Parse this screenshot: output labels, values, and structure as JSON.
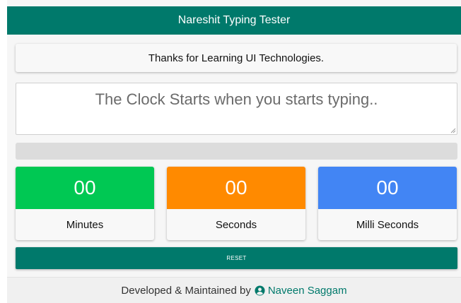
{
  "header": {
    "title": "Nareshit Typing Tester"
  },
  "quote": {
    "text": "Thanks for Learning UI Technologies."
  },
  "typing": {
    "placeholder": "The Clock Starts when you starts typing..",
    "value": ""
  },
  "progress": {
    "percent": 0
  },
  "timers": [
    {
      "value": "00",
      "label": "Minutes",
      "color": "#00c853"
    },
    {
      "value": "00",
      "label": "Seconds",
      "color": "#ff8a00"
    },
    {
      "value": "00",
      "label": "Milli Seconds",
      "color": "#4285f4"
    }
  ],
  "reset": {
    "label": "RESET"
  },
  "footer": {
    "prefix": "Developed & Maintained by",
    "author": "Naveen Saggam",
    "author_icon": "user-circle-icon"
  },
  "colors": {
    "primary": "#00796b"
  }
}
